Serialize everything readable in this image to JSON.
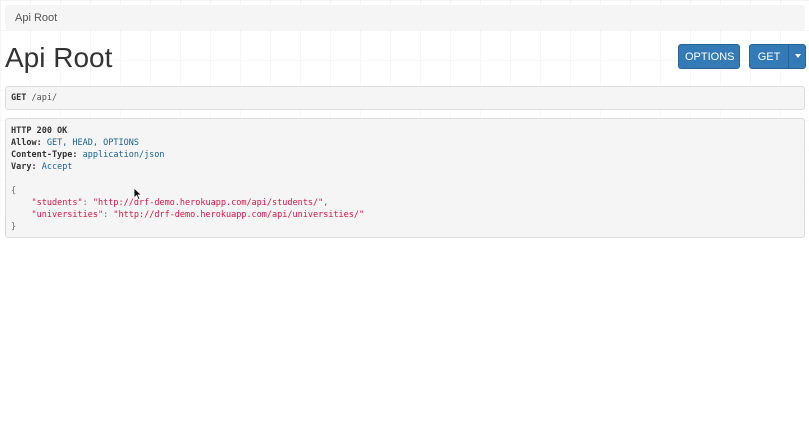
{
  "breadcrumb": {
    "item": "Api Root"
  },
  "page": {
    "title": "Api Root"
  },
  "toolbar": {
    "options_label": "OPTIONS",
    "get_label": "GET"
  },
  "request": {
    "method": "GET",
    "path": "/api/"
  },
  "response": {
    "status": "HTTP 200 OK",
    "headers": [
      {
        "name": "Allow:",
        "value": "GET, HEAD, OPTIONS"
      },
      {
        "name": "Content-Type:",
        "value": "application/json"
      },
      {
        "name": "Vary:",
        "value": "Accept"
      }
    ],
    "body": {
      "open": "{",
      "close": "}",
      "entries": [
        {
          "key": "\"students\"",
          "value": "\"http://drf-demo.herokuapp.com/api/students/\"",
          "sep": ":",
          "trail": ","
        },
        {
          "key": "\"universities\"",
          "value": "\"http://drf-demo.herokuapp.com/api/universities/\"",
          "sep": ":",
          "trail": ""
        }
      ]
    }
  },
  "colors": {
    "primary": "#337ab7",
    "string": "#dd1144",
    "literal": "#195f91"
  },
  "icons": {
    "cursor": "mouse-pointer-icon",
    "caret": "caret-down-icon"
  }
}
